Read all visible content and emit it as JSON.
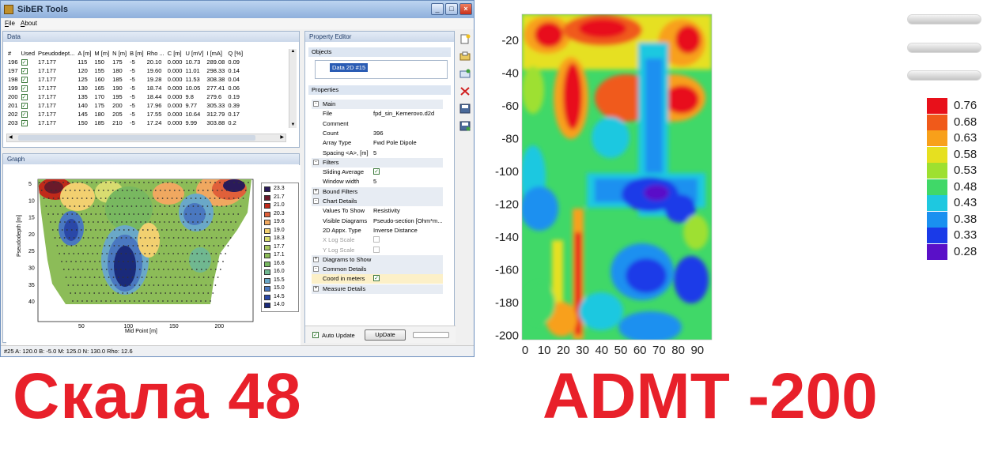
{
  "window": {
    "title": "SibER Tools"
  },
  "menu": [
    {
      "label": "File",
      "accel": "F",
      "rest": "ile"
    },
    {
      "label": "About",
      "accel": "A",
      "rest": "bout"
    }
  ],
  "data_panel": {
    "title": "Data",
    "columns": [
      "#",
      "Used",
      "Pseudodept...",
      "A [m]",
      "M [m]",
      "N [m]",
      "B [m]",
      "Rho ...",
      "C [m]",
      "U [mV]",
      "I [mA]",
      "Q [%]"
    ],
    "rows": [
      [
        "196",
        "",
        "17.177",
        "115",
        "150",
        "175",
        "-5",
        "20.10",
        "0.000",
        "10.73",
        "289.08",
        "0.09"
      ],
      [
        "197",
        "",
        "17.177",
        "120",
        "155",
        "180",
        "-5",
        "19.60",
        "0.000",
        "11.01",
        "298.33",
        "0.14"
      ],
      [
        "198",
        "",
        "17.177",
        "125",
        "160",
        "185",
        "-5",
        "19.28",
        "0.000",
        "11.53",
        "308.38",
        "0.04"
      ],
      [
        "199",
        "",
        "17.177",
        "130",
        "165",
        "190",
        "-5",
        "18.74",
        "0.000",
        "10.05",
        "277.41",
        "0.06"
      ],
      [
        "200",
        "",
        "17.177",
        "135",
        "170",
        "195",
        "-5",
        "18.44",
        "0.000",
        "9.8",
        "279.6",
        "0.19"
      ],
      [
        "201",
        "",
        "17.177",
        "140",
        "175",
        "200",
        "-5",
        "17.96",
        "0.000",
        "9.77",
        "305.33",
        "0.39"
      ],
      [
        "202",
        "",
        "17.177",
        "145",
        "180",
        "205",
        "-5",
        "17.55",
        "0.000",
        "10.64",
        "312.79",
        "0.17"
      ],
      [
        "203",
        "",
        "17.177",
        "150",
        "185",
        "210",
        "-5",
        "17.24",
        "0.000",
        "9.99",
        "303.88",
        "0.2"
      ]
    ]
  },
  "graph_panel": {
    "title": "Graph",
    "ylabel": "Pseudodepth [m]",
    "xlabel": "Mid Point [m]",
    "yticks": [
      "5",
      "10",
      "15",
      "20",
      "25",
      "30",
      "35",
      "40"
    ],
    "xticks": [
      "50",
      "100",
      "150",
      "200"
    ],
    "legend": [
      {
        "label": "23.3",
        "color": "#2a1a5a"
      },
      {
        "label": "21.7",
        "color": "#6a1a2a"
      },
      {
        "label": "21.0",
        "color": "#c02a1a"
      },
      {
        "label": "20.3",
        "color": "#e0603a"
      },
      {
        "label": "19.6",
        "color": "#f0a860"
      },
      {
        "label": "19.0",
        "color": "#f2d070"
      },
      {
        "label": "18.3",
        "color": "#d8dc70"
      },
      {
        "label": "17.7",
        "color": "#a8c860"
      },
      {
        "label": "17.1",
        "color": "#8cbc58"
      },
      {
        "label": "16.6",
        "color": "#78b860"
      },
      {
        "label": "16.0",
        "color": "#70b890"
      },
      {
        "label": "15.5",
        "color": "#6aa8c8"
      },
      {
        "label": "15.0",
        "color": "#4a78c0"
      },
      {
        "label": "14.5",
        "color": "#2a48a8"
      },
      {
        "label": "14.0",
        "color": "#1a2a7a"
      }
    ]
  },
  "property_editor": {
    "title": "Property Editor",
    "objects_label": "Objects",
    "object_selected": "Data 2D #15",
    "properties_label": "Properties",
    "items": [
      {
        "kind": "cat",
        "label": "Main",
        "sign": "-"
      },
      {
        "kind": "row",
        "key": "File",
        "value": "fpd_sin_Kemerovo.d2d"
      },
      {
        "kind": "row",
        "key": "Comment",
        "value": ""
      },
      {
        "kind": "row",
        "key": "Count",
        "value": "396"
      },
      {
        "kind": "row",
        "key": "Array Type",
        "value": "Fwd Pole Dipole"
      },
      {
        "kind": "row",
        "key": "Spacing <A>, [m]",
        "value": "5"
      },
      {
        "kind": "cat",
        "label": "Filters",
        "sign": "-"
      },
      {
        "kind": "rowchk",
        "key": "Sliding Average",
        "value": ""
      },
      {
        "kind": "row",
        "key": "   Window width",
        "value": "5"
      },
      {
        "kind": "cat",
        "label": "Bound Filters",
        "sign": "+"
      },
      {
        "kind": "cat",
        "label": "Chart Details",
        "sign": "-"
      },
      {
        "kind": "row",
        "key": "Values To Show",
        "value": "Resistivity"
      },
      {
        "kind": "row",
        "key": "Visible Diagrams",
        "value": "Pseudo-section [Ohm*m..."
      },
      {
        "kind": "row",
        "key": "2D Appx. Type",
        "value": "Inverse Distance"
      },
      {
        "kind": "rowchkgray",
        "key": "X Log Scale",
        "value": ""
      },
      {
        "kind": "rowchkgray",
        "key": "Y Log Scale",
        "value": ""
      },
      {
        "kind": "cat",
        "label": "Diagrams to Show",
        "sign": "+"
      },
      {
        "kind": "cat",
        "label": "Common Details",
        "sign": "-"
      },
      {
        "kind": "rowchkhl",
        "key": "Coord in meters",
        "value": ""
      },
      {
        "kind": "cat",
        "label": "Measure Details",
        "sign": "+"
      }
    ],
    "auto_update_label": "Auto Update",
    "update_button": "UpDate"
  },
  "status_text": "#25 A: 120.0 B: -5.0 M: 125.0 N: 130.0 Rho: 12.6",
  "right_chart": {
    "yticks": [
      "-20",
      "-40",
      "-60",
      "-80",
      "-100",
      "-120",
      "-140",
      "-160",
      "-180",
      "-200"
    ],
    "xticks": [
      "0",
      "10",
      "20",
      "30",
      "40",
      "50",
      "60",
      "70",
      "80",
      "90"
    ],
    "legend": [
      {
        "label": "0.76",
        "color": "#e8101a"
      },
      {
        "label": "0.68",
        "color": "#f05a1a"
      },
      {
        "label": "0.63",
        "color": "#f8a01a"
      },
      {
        "label": "0.58",
        "color": "#e6e020"
      },
      {
        "label": "0.53",
        "color": "#9ee030"
      },
      {
        "label": "0.48",
        "color": "#40d868"
      },
      {
        "label": "0.43",
        "color": "#1ec8e0"
      },
      {
        "label": "0.38",
        "color": "#1a90f0"
      },
      {
        "label": "0.33",
        "color": "#1a3ae8"
      },
      {
        "label": "0.28",
        "color": "#5a10c8"
      }
    ]
  },
  "caption_left": "Скала 48",
  "caption_right": "ADMT -200"
}
